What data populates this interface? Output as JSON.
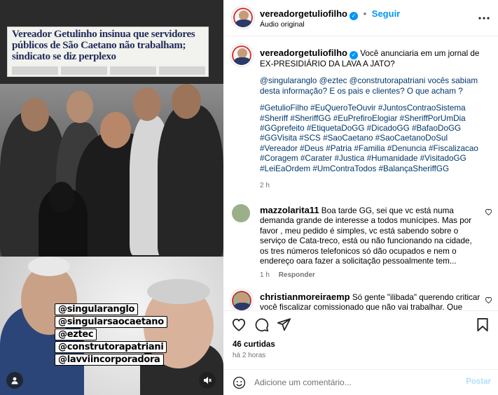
{
  "header": {
    "username": "vereadorgetuliofilho",
    "separator": "•",
    "follow_label": "Seguir",
    "audio_label": "Áudio original",
    "more_icon": "more-horizontal-icon"
  },
  "media": {
    "clipping_headline": "Vereador Getulinho insinua que servidores públicos de São Caetano não trabalham; sindicato se diz perplexo",
    "tag_lines": [
      "@singularanglo",
      "@singularsaocaetano",
      "@eztec",
      "@construtorapatriani",
      "@lavviincorporadora"
    ],
    "profile_icon": "tagged-user-icon",
    "mute_icon": "muted-speaker-icon"
  },
  "caption": {
    "username": "vereadorgetuliofilho",
    "text": "Você anunciaria em um jornal de EX-PRESIDIÁRIO DA LAVA A JATO?",
    "mentions_line": "@singularanglo @eztec @construtorapatriani vocês sabiam desta informação? E os pais e clientes? O que acham ?",
    "hashtags": "#GetulioFilho #EuQueroTeOuvir #JuntosContraoSistema #Sheriff #SheriffGG #EuPrefiroElogiar #SheriffPorUmDia #GGprefeito #EtiquetaDoGG #DicadoGG #BafaoDoGG #GGVisita #SCS #SaoCaetano #SaoCaetanoDoSul #Vereador #Deus #Patria #Familia #Denuncia #Fiscalizacao #Coragem #Carater #Justica #Humanidade #VisitadoGG #LeiEaOrdem #UmContraTodos #BalançaSheriffGG",
    "time": "2 h"
  },
  "comments": [
    {
      "username": "mazzolarita11",
      "text": "Boa tarde GG, sei que vc está numa demanda grande de interesse a todos munícipes. Mas por favor , meu pedido é simples, vc está sabendo sobre o serviço de Cata-treco, está ou não funcionando na cidade, os tres números telefonicos só dão ocupados e nem o endereço oara fazer a solicitação pessoalmente tem...",
      "time": "1 h",
      "reply_label": "Responder"
    },
    {
      "username": "christianmoreiraemp",
      "text": "Só gente \"ilibada\" querendo criticar você fiscalizar comissionado que não vai trabalhar. Que coisa. 😂",
      "time": "",
      "reply_label": ""
    }
  ],
  "actions": {
    "like_icon": "heart-icon",
    "comment_icon": "comment-bubble-icon",
    "share_icon": "share-send-icon",
    "save_icon": "bookmark-icon",
    "likes": "46 curtidas",
    "age": "há 2 horas"
  },
  "compose": {
    "emoji_icon": "emoji-smile-icon",
    "placeholder": "Adicione um comentário...",
    "post_label": "Postar"
  },
  "colors": {
    "accent": "#0095f6",
    "link": "#00376b",
    "muted": "#737373",
    "post_disabled": "#b2dffc"
  }
}
